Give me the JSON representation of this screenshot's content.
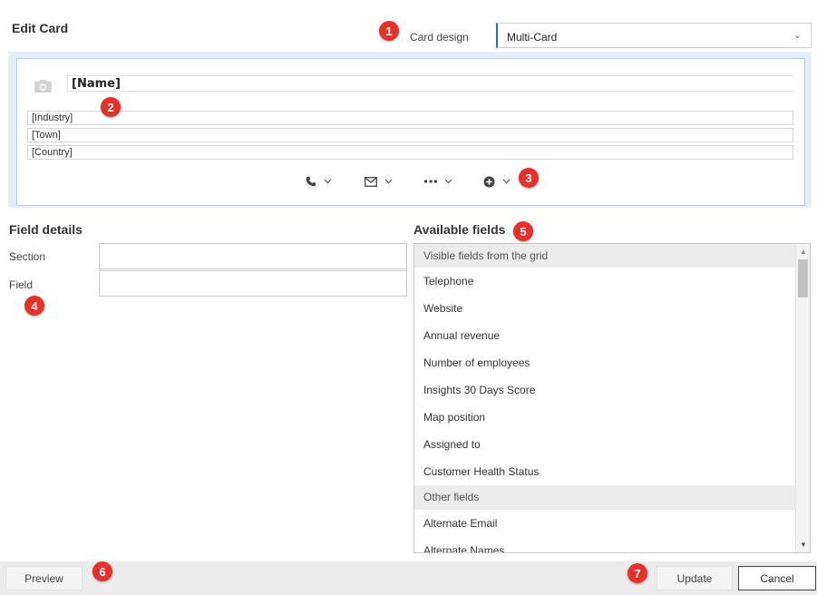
{
  "dialog": {
    "title": "Edit Card"
  },
  "card_design": {
    "label": "Card design",
    "value": "Multi-Card"
  },
  "card": {
    "name": "[Name]",
    "fields": [
      "[Industry]",
      "[Town]",
      "[Country]"
    ],
    "actions": [
      {
        "icon": "phone-icon"
      },
      {
        "icon": "envelope-icon"
      },
      {
        "icon": "more-icon"
      },
      {
        "icon": "plus-circle-icon"
      }
    ]
  },
  "field_details": {
    "title": "Field details",
    "section_label": "Section",
    "section_value": "",
    "field_label": "Field",
    "field_value": ""
  },
  "available_fields": {
    "title": "Available fields",
    "groups": [
      {
        "label": "Visible fields from the grid",
        "items": [
          "Telephone",
          "Website",
          "Annual revenue",
          "Number of employees",
          "Insights 30 Days Score",
          "Map position",
          "Assigned to",
          "Customer Health Status"
        ]
      },
      {
        "label": "Other fields",
        "items": [
          "Alternate Email",
          "Alternate Names"
        ]
      }
    ]
  },
  "footer": {
    "preview": "Preview",
    "update": "Update",
    "cancel": "Cancel"
  },
  "callouts": [
    "1",
    "2",
    "3",
    "4",
    "5",
    "6",
    "7"
  ],
  "colors": {
    "accent": "#2a6fb0",
    "callout": "#e8302a",
    "card_bg": "#e7eef7"
  }
}
